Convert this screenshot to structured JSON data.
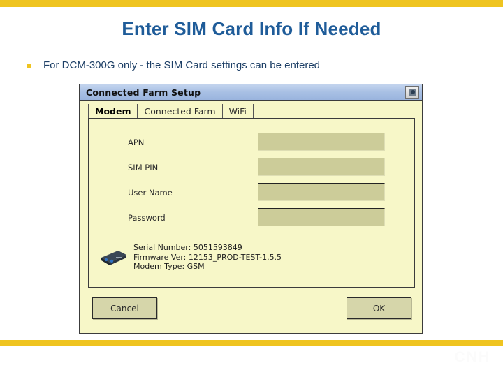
{
  "slide": {
    "title": "Enter SIM Card Info If Needed",
    "bullet_text": "For DCM-300G only  - the SIM Card settings can be entered",
    "watermark": "CNH",
    "accent_color": "#efc420",
    "title_color": "#1f5c99",
    "body_text_color": "#1d3f66"
  },
  "dialog": {
    "title": "Connected Farm Setup",
    "titlebar_button_icon": "camera-globe-icon",
    "background_color": "#f7f7c8",
    "titlebar_color": "#a8c0e4",
    "input_color": "#cccc99",
    "tabs": [
      {
        "label": "Modem",
        "active": true
      },
      {
        "label": "Connected Farm",
        "active": false
      },
      {
        "label": "WiFi",
        "active": false
      }
    ],
    "fields": [
      {
        "label": "APN",
        "value": "",
        "placeholder": ""
      },
      {
        "label": "SIM PIN",
        "value": "",
        "placeholder": ""
      },
      {
        "label": "User Name",
        "value": "",
        "placeholder": ""
      },
      {
        "label": "Password",
        "value": "",
        "placeholder": ""
      }
    ],
    "device_info": {
      "icon": "modem-device-icon",
      "serial_number": "Serial Number: 5051593849",
      "firmware_version": "Firmware Ver: 12153_PROD-TEST-1.5.5",
      "modem_type": "Modem Type: GSM"
    },
    "buttons": {
      "cancel": "Cancel",
      "ok": "OK"
    }
  }
}
